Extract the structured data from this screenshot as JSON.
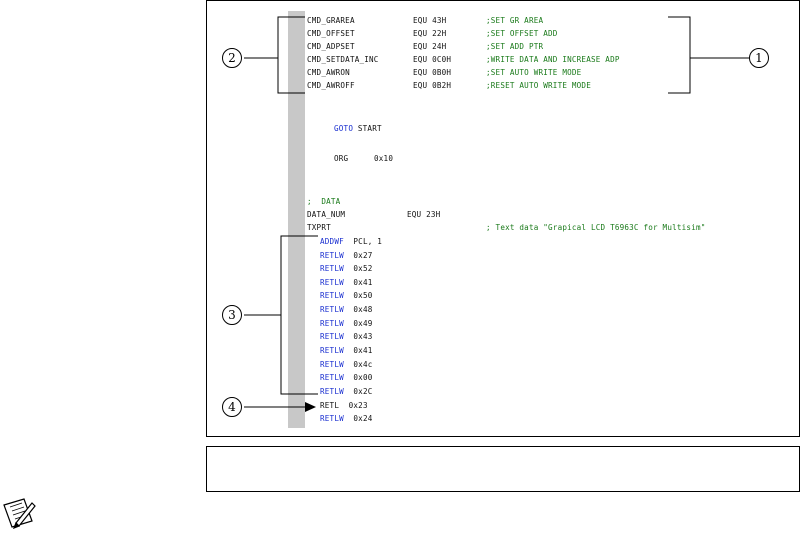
{
  "code": {
    "equates": [
      {
        "name": "CMD_GRAREA",
        "op": "EQU",
        "val": "43H",
        "comment": ";SET GR AREA"
      },
      {
        "name": "CMD_OFFSET",
        "op": "EQU",
        "val": "22H",
        "comment": ";SET OFFSET ADD"
      },
      {
        "name": "CMD_ADPSET",
        "op": "EQU",
        "val": "24H",
        "comment": ";SET ADD PTR"
      },
      {
        "name": "CMD_SETDATA_INC",
        "op": "EQU",
        "val": "0C0H",
        "comment": ";WRITE DATA AND INCREASE ADP"
      },
      {
        "name": "CMD_AWRON",
        "op": "EQU",
        "val": "0B0H",
        "comment": ";SET AUTO WRITE MODE"
      },
      {
        "name": "CMD_AWROFF",
        "op": "EQU",
        "val": "0B2H",
        "comment": ";RESET AUTO WRITE MODE"
      }
    ],
    "goto_kw": "GOTO",
    "goto_arg": "START",
    "org_kw": "ORG",
    "org_arg": "0x10",
    "data_comment": ";  DATA",
    "data_num_name": "DATA_NUM",
    "data_num_op": "EQU",
    "data_num_val": "23H",
    "txprt_label": "TXPRT",
    "txprt_comment": "; Text data \"Grapical LCD T6963C for Multisim\"",
    "addwf_kw": "ADDWF",
    "addwf_arg": "PCL, 1",
    "retlw_rows": [
      {
        "kw": "RETLW",
        "arg": "0x27"
      },
      {
        "kw": "RETLW",
        "arg": "0x52"
      },
      {
        "kw": "RETLW",
        "arg": "0x41"
      },
      {
        "kw": "RETLW",
        "arg": "0x50"
      },
      {
        "kw": "RETLW",
        "arg": "0x48"
      },
      {
        "kw": "RETLW",
        "arg": "0x49"
      },
      {
        "kw": "RETLW",
        "arg": "0x43"
      },
      {
        "kw": "RETLW",
        "arg": "0x41"
      },
      {
        "kw": "RETLW",
        "arg": "0x4c"
      },
      {
        "kw": "RETLW",
        "arg": "0x00"
      },
      {
        "kw": "RETLW",
        "arg": "0x2C"
      }
    ],
    "error_line": "RETL  0x23",
    "last_kw": "RETLW",
    "last_arg": "0x24"
  },
  "callouts": {
    "c1": "1",
    "c2": "2",
    "c3": "3",
    "c4": "4"
  },
  "colors": {
    "keyword": "#1a2fd0",
    "comment": "#1a7a1a",
    "gutter": "#c8c8c8"
  },
  "icons": {
    "note": "note-pencil-icon"
  }
}
